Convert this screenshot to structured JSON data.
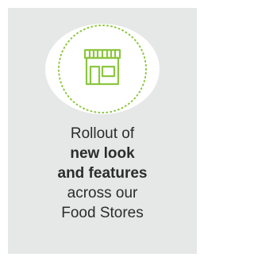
{
  "card": {
    "icon": "storefront-icon",
    "accent_color": "#8cc63f",
    "lines": [
      "Rollout of",
      "new look",
      "and features",
      "across our",
      "Food Stores"
    ]
  }
}
